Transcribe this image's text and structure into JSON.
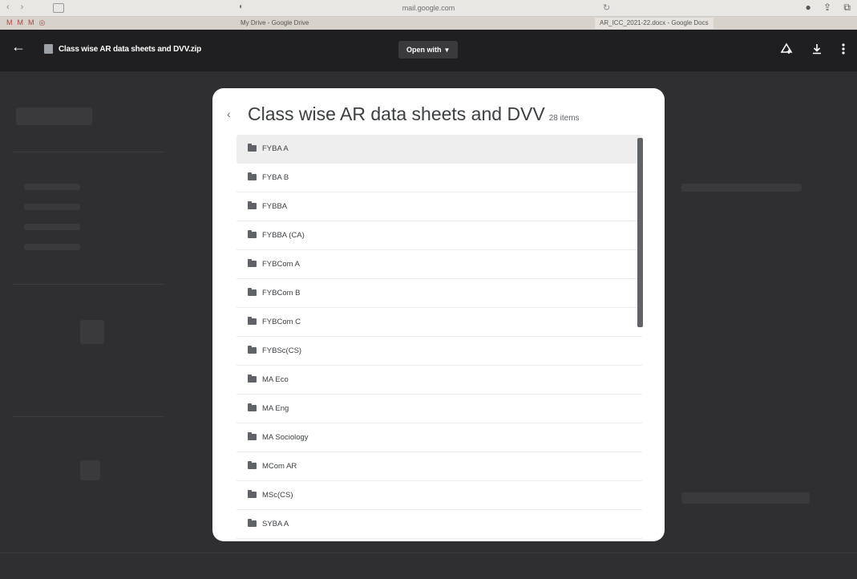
{
  "browser": {
    "url": "mail.google.com",
    "tabs": [
      {
        "label": "My Drive - Google Drive"
      },
      {
        "label": "AR_ICC_2021-22.docx - Google Docs"
      }
    ]
  },
  "header": {
    "file_name": "Class wise AR data sheets and DVV.zip",
    "open_with_label": "Open with"
  },
  "icons": {
    "back": "arrow-left-icon",
    "file": "zip-file-icon",
    "add_to_drive": "add-to-drive-icon",
    "download": "download-icon",
    "more": "more-vert-icon",
    "folder": "folder-icon"
  },
  "panel": {
    "title": "Class wise AR data sheets and DVV",
    "item_count": "28 items",
    "items": [
      {
        "name": "FYBA A"
      },
      {
        "name": "FYBA B"
      },
      {
        "name": "FYBBA"
      },
      {
        "name": "FYBBA (CA)"
      },
      {
        "name": "FYBCom A"
      },
      {
        "name": "FYBCom B"
      },
      {
        "name": "FYBCom C"
      },
      {
        "name": "FYBSc(CS)"
      },
      {
        "name": "MA Eco"
      },
      {
        "name": "MA Eng"
      },
      {
        "name": "MA Sociology"
      },
      {
        "name": "MCom AR"
      },
      {
        "name": "MSc(CS)"
      },
      {
        "name": "SYBA A"
      }
    ]
  },
  "colors": {
    "header_bg": "#1f1f21",
    "backdrop": "#2f2f31",
    "panel_bg": "#ffffff",
    "selected_row": "#eeeeee",
    "folder_icon": "#5f6368"
  }
}
